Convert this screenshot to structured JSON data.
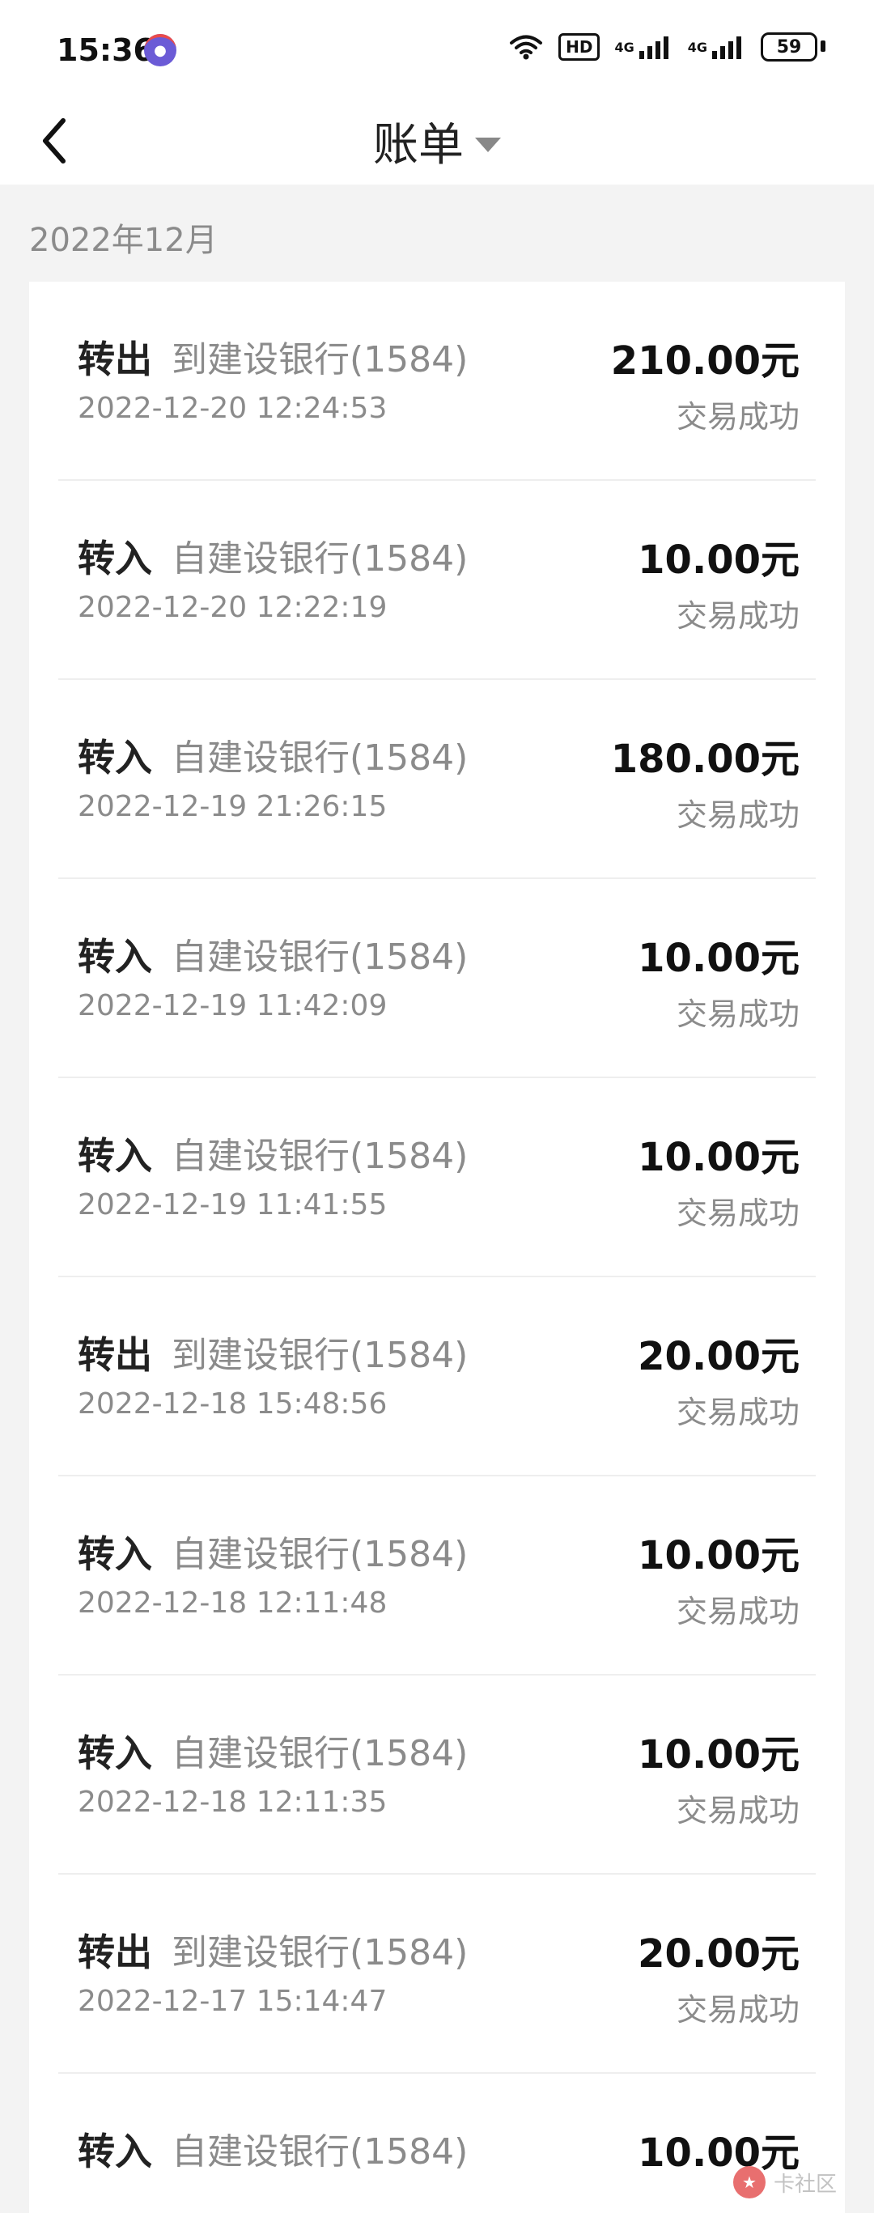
{
  "status_bar": {
    "time": "15:36",
    "hd": "HD",
    "network_1": "4G",
    "network_2": "4G",
    "battery": "59"
  },
  "header": {
    "title": "账单"
  },
  "section": {
    "month": "2022年12月"
  },
  "transactions": [
    {
      "type": "转出",
      "bank": "到建设银行(1584)",
      "datetime": "2022-12-20 12:24:53",
      "amount": "210.00元",
      "status": "交易成功"
    },
    {
      "type": "转入",
      "bank": "自建设银行(1584)",
      "datetime": "2022-12-20 12:22:19",
      "amount": "10.00元",
      "status": "交易成功"
    },
    {
      "type": "转入",
      "bank": "自建设银行(1584)",
      "datetime": "2022-12-19 21:26:15",
      "amount": "180.00元",
      "status": "交易成功"
    },
    {
      "type": "转入",
      "bank": "自建设银行(1584)",
      "datetime": "2022-12-19 11:42:09",
      "amount": "10.00元",
      "status": "交易成功"
    },
    {
      "type": "转入",
      "bank": "自建设银行(1584)",
      "datetime": "2022-12-19 11:41:55",
      "amount": "10.00元",
      "status": "交易成功"
    },
    {
      "type": "转出",
      "bank": "到建设银行(1584)",
      "datetime": "2022-12-18 15:48:56",
      "amount": "20.00元",
      "status": "交易成功"
    },
    {
      "type": "转入",
      "bank": "自建设银行(1584)",
      "datetime": "2022-12-18 12:11:48",
      "amount": "10.00元",
      "status": "交易成功"
    },
    {
      "type": "转入",
      "bank": "自建设银行(1584)",
      "datetime": "2022-12-18 12:11:35",
      "amount": "10.00元",
      "status": "交易成功"
    },
    {
      "type": "转出",
      "bank": "到建设银行(1584)",
      "datetime": "2022-12-17 15:14:47",
      "amount": "20.00元",
      "status": "交易成功"
    },
    {
      "type": "转入",
      "bank": "自建设银行(1584)",
      "datetime": "",
      "amount": "10.00元",
      "status": ""
    }
  ],
  "watermark": {
    "text": "卡社区"
  }
}
